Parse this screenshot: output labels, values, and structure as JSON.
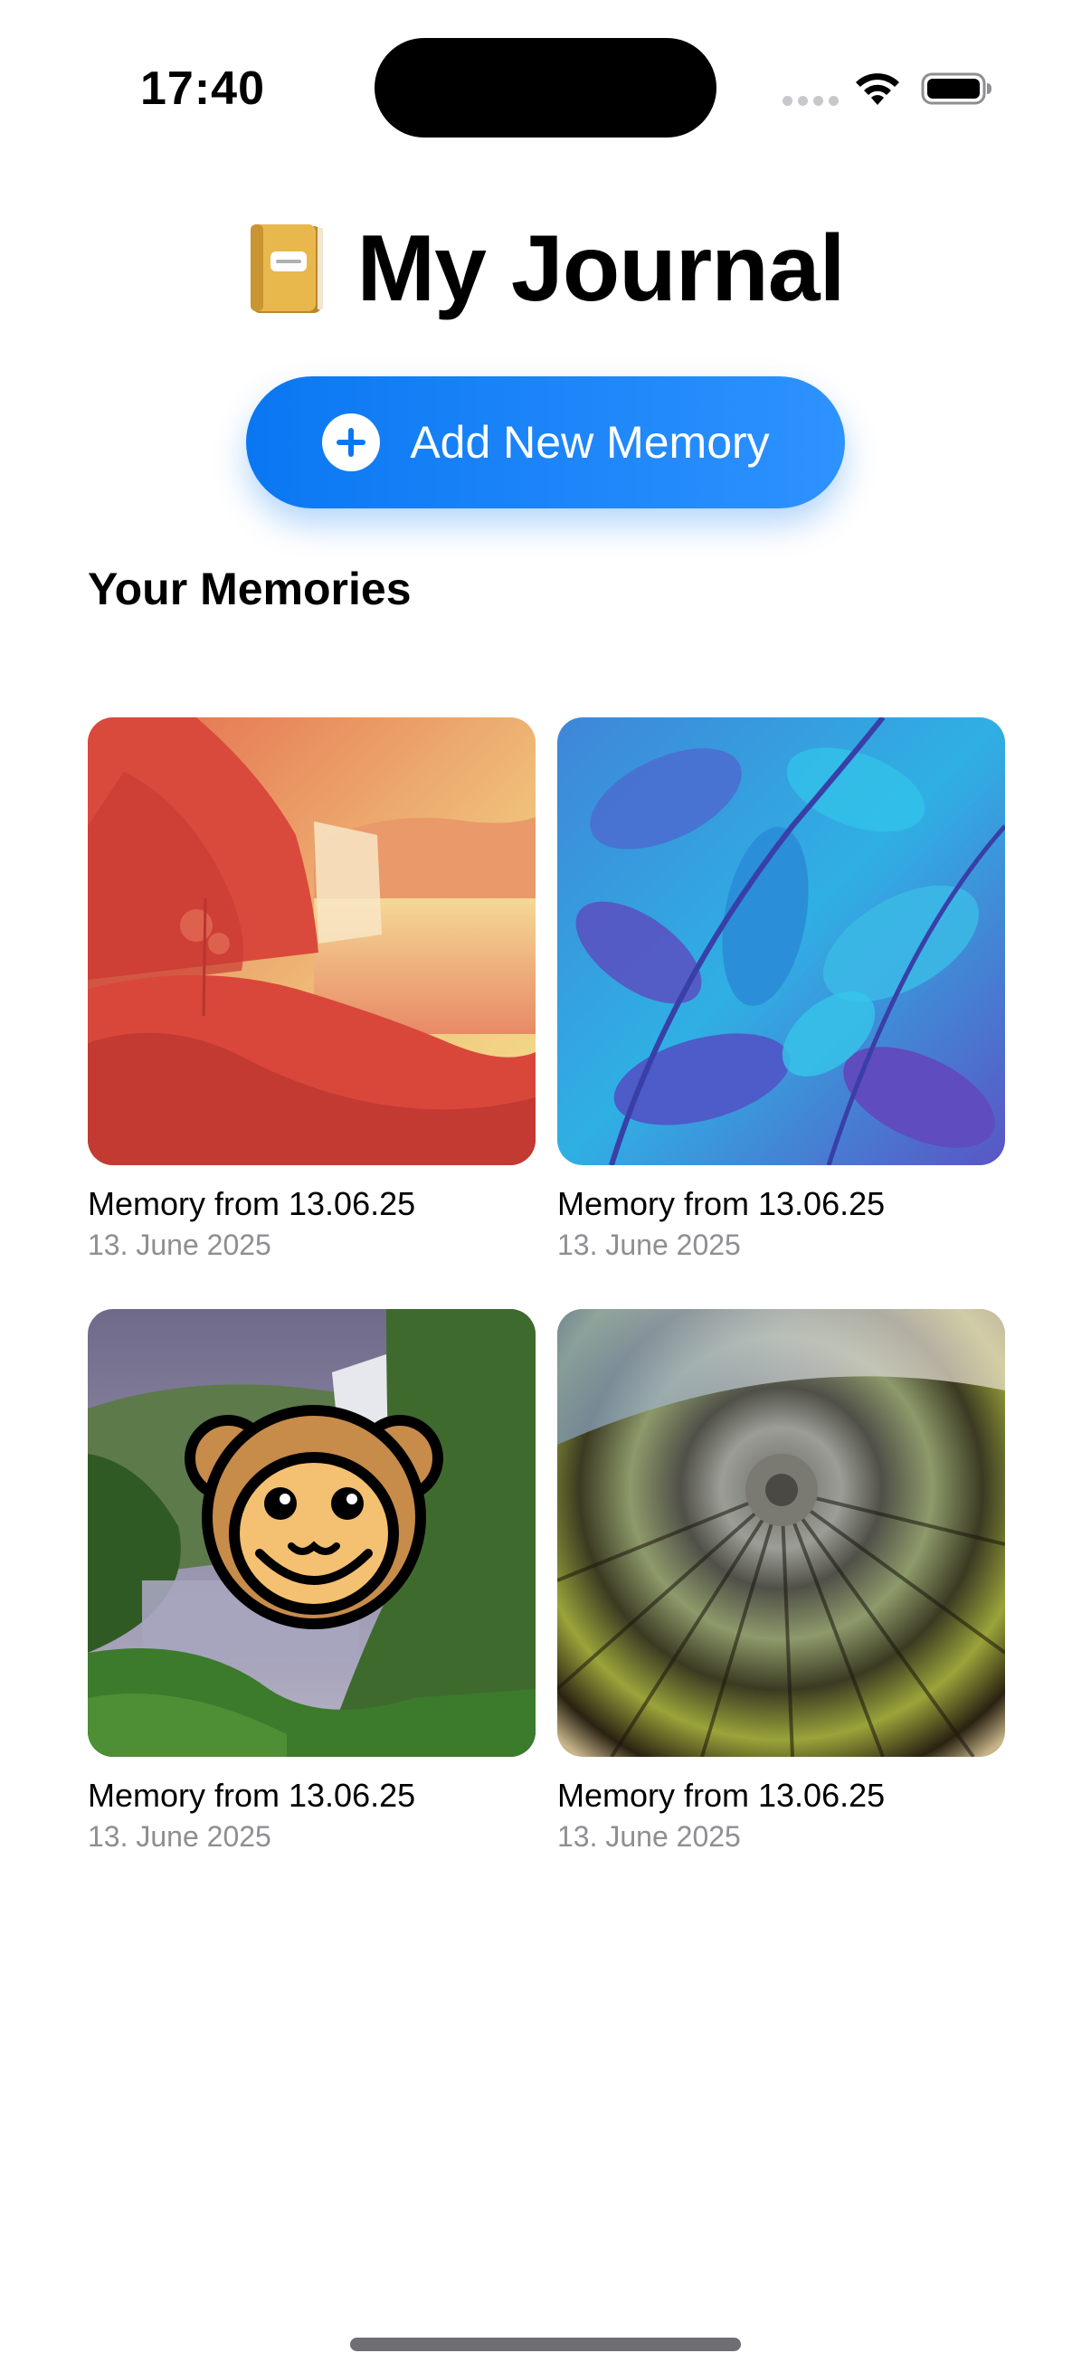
{
  "status_bar": {
    "time": "17:40"
  },
  "header": {
    "icon": "notebook-icon",
    "title": "My Journal"
  },
  "add_button": {
    "icon": "plus-circle-icon",
    "label": "Add New Memory",
    "color": "#0A77F2"
  },
  "section": {
    "title": "Your Memories"
  },
  "memories": [
    {
      "title": "Memory from 13.06.25",
      "date": "13. June 2025",
      "image": "waterfall-red-tint"
    },
    {
      "title": "Memory from 13.06.25",
      "date": "13. June 2025",
      "image": "leaves-blue-tint"
    },
    {
      "title": "Memory from 13.06.25",
      "date": "13. June 2025",
      "image": "waterfall-with-monkey-sticker"
    },
    {
      "title": "Memory from 13.06.25",
      "date": "13. June 2025",
      "image": "radial-abstract"
    }
  ],
  "colors": {
    "accent": "#0A77F2",
    "secondary_text": "#8E8E93"
  }
}
